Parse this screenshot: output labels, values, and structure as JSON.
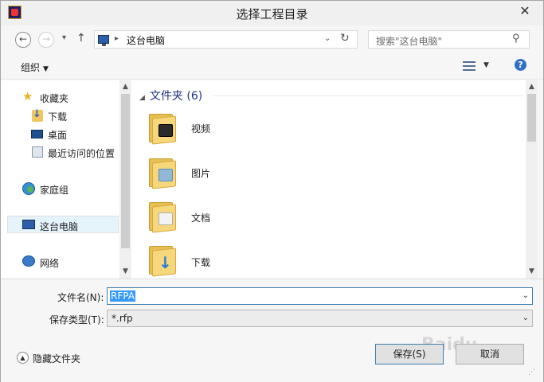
{
  "window": {
    "title": "选择工程目录",
    "close_glyph": "✕"
  },
  "navigation": {
    "back_glyph": "←",
    "forward_glyph": "→",
    "recent_glyph": "▾",
    "up_glyph": "↑",
    "address": {
      "separator": "▸",
      "crumb": "这台电脑",
      "dropdown_glyph": "⌄",
      "refresh_glyph": "↻"
    },
    "search": {
      "placeholder": "搜索\"这台电脑\"",
      "icon": "search-icon"
    }
  },
  "toolbar": {
    "organize_label": "组织",
    "caret": "▼",
    "help_glyph": "?"
  },
  "sidebar": {
    "items": [
      {
        "label": "收藏夹",
        "icon": "star-icon"
      },
      {
        "label": "下载",
        "icon": "downloads-icon"
      },
      {
        "label": "桌面",
        "icon": "desktop-icon"
      },
      {
        "label": "最近访问的位置",
        "icon": "recent-places-icon"
      },
      {
        "label": "家庭组",
        "icon": "homegroup-icon"
      },
      {
        "label": "这台电脑",
        "icon": "this-pc-icon",
        "selected": true
      },
      {
        "label": "网络",
        "icon": "network-icon"
      }
    ],
    "scroll_up": "▲",
    "scroll_down": "▼"
  },
  "content": {
    "group_header": "文件夹 (6)",
    "group_toggle": "◢",
    "folders": [
      {
        "label": "视频",
        "icon": "videos-folder-icon"
      },
      {
        "label": "图片",
        "icon": "pictures-folder-icon"
      },
      {
        "label": "文档",
        "icon": "documents-folder-icon"
      },
      {
        "label": "下载",
        "icon": "downloads-folder-icon"
      }
    ],
    "scroll_up": "▲",
    "scroll_down": "▼"
  },
  "form": {
    "filename_label": "文件名(N):",
    "filename_value": "RFPA",
    "filetype_label": "保存类型(T):",
    "filetype_value": "*.rfp",
    "dropdown_glyph": "⌄"
  },
  "footer": {
    "hide_folders_label": "隐藏文件夹",
    "hide_folders_glyph": "▲",
    "save_label": "保存(S)",
    "cancel_label": "取消"
  },
  "colors": {
    "accent": "#3399ff",
    "header_blue": "#1e3287",
    "folder_yellow": "#f7d77b"
  }
}
